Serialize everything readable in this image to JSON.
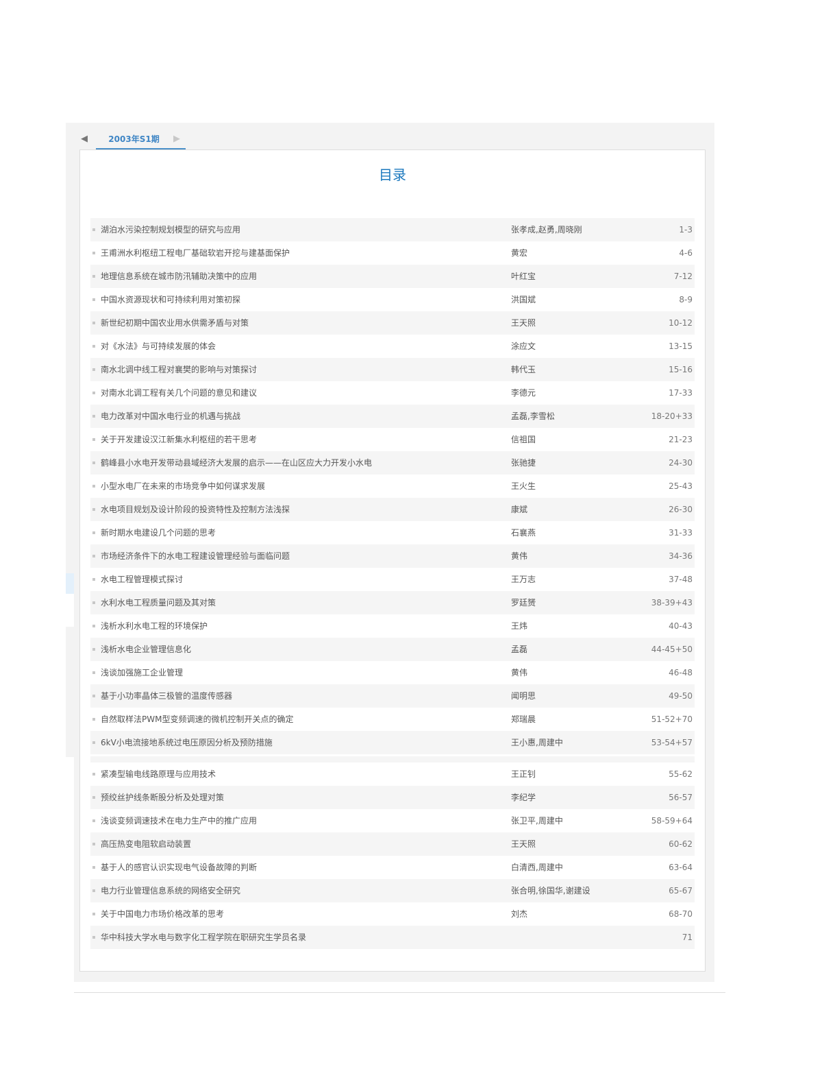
{
  "tabs": {
    "active_label": "2003年S1期",
    "prev_glyph": "◀",
    "next_glyph": "▶"
  },
  "toc": {
    "heading": "目录",
    "items": [
      {
        "title": "湖泊水污染控制规划模型的研究与应用",
        "authors": "张孝成,赵勇,周晓刚",
        "pages": "1-3"
      },
      {
        "title": "王甫洲水利枢纽工程电厂基础软岩开挖与建基面保护",
        "authors": "黄宏",
        "pages": "4-6"
      },
      {
        "title": "地理信息系统在城市防汛辅助决策中的应用",
        "authors": "叶红宝",
        "pages": "7-12"
      },
      {
        "title": "中国水资源现状和可持续利用对策初探",
        "authors": "洪国斌",
        "pages": "8-9"
      },
      {
        "title": "新世纪初期中国农业用水供需矛盾与对策",
        "authors": "王天照",
        "pages": "10-12"
      },
      {
        "title": "对《水法》与可持续发展的体会",
        "authors": "涂应文",
        "pages": "13-15"
      },
      {
        "title": "南水北调中线工程对襄樊的影响与对策探讨",
        "authors": "韩代玉",
        "pages": "15-16"
      },
      {
        "title": "对南水北调工程有关几个问题的意见和建议",
        "authors": "李德元",
        "pages": "17-33"
      },
      {
        "title": "电力改革对中国水电行业的机遇与挑战",
        "authors": "孟磊,李雪松",
        "pages": "18-20+33"
      },
      {
        "title": "关于开发建设汉江新集水利枢纽的若干思考",
        "authors": "信祖国",
        "pages": "21-23"
      },
      {
        "title": "鹤峰县小水电开发带动县域经济大发展的启示——在山区应大力开发小水电",
        "authors": "张驰捷",
        "pages": "24-30"
      },
      {
        "title": "小型水电厂在未来的市场竞争中如何谋求发展",
        "authors": "王火生",
        "pages": "25-43"
      },
      {
        "title": "水电项目规划及设计阶段的投资特性及控制方法浅探",
        "authors": "康斌",
        "pages": "26-30"
      },
      {
        "title": "新时期水电建设几个问题的思考",
        "authors": "石襄燕",
        "pages": "31-33"
      },
      {
        "title": "市场经济条件下的水电工程建设管理经验与面临问题",
        "authors": "黄伟",
        "pages": "34-36"
      },
      {
        "title": "水电工程管理模式探讨",
        "authors": "王万志",
        "pages": "37-48"
      },
      {
        "title": "水利水电工程质量问题及其对策",
        "authors": "罗廷赟",
        "pages": "38-39+43"
      },
      {
        "title": "浅析水利水电工程的环境保护",
        "authors": "王炜",
        "pages": "40-43"
      },
      {
        "title": "浅析水电企业管理信息化",
        "authors": "孟磊",
        "pages": "44-45+50"
      },
      {
        "title": "浅谈加强施工企业管理",
        "authors": "黄伟",
        "pages": "46-48"
      },
      {
        "title": "基于小功率晶体三极管的温度传感器",
        "authors": "闻明思",
        "pages": "49-50"
      },
      {
        "title": "自然取样法PWM型变频调速的微机控制开关点的确定",
        "authors": "郑瑞晨",
        "pages": "51-52+70"
      },
      {
        "title": "6kV小电流接地系统过电压原因分析及预防措施",
        "authors": "王小惠,周建中",
        "pages": "53-54+57"
      },
      {
        "title": "紧凑型输电线路原理与应用技术",
        "authors": "王正钊",
        "pages": "55-62"
      },
      {
        "title": "预绞丝护线条断股分析及处理对策",
        "authors": "李纪学",
        "pages": "56-57"
      },
      {
        "title": "浅谈变频调速技术在电力生产中的推广应用",
        "authors": "张卫平,周建中",
        "pages": "58-59+64"
      },
      {
        "title": "高压热变电阻软启动装置",
        "authors": "王天照",
        "pages": "60-62"
      },
      {
        "title": "基于人的感官认识实现电气设备故障的判断",
        "authors": "白清西,周建中",
        "pages": "63-64"
      },
      {
        "title": "电力行业管理信息系统的网络安全研究",
        "authors": "张合明,徐国华,谢建设",
        "pages": "65-67"
      },
      {
        "title": "关于中国电力市场价格改革的思考",
        "authors": "刘杰",
        "pages": "68-70"
      },
      {
        "title": "华中科技大学水电与数字化工程学院在职研究生学员名录",
        "authors": "",
        "pages": "71"
      }
    ]
  }
}
